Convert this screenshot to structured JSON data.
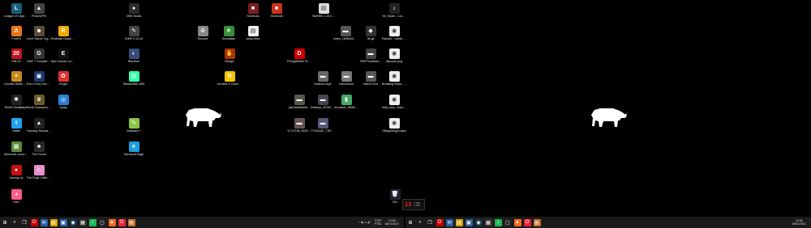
{
  "colors": {
    "desktop": "#000000",
    "taskbar": "#1b1b1b",
    "accent": "#e21b1b"
  },
  "desktop_icons": [
    {
      "label": "League of Legends",
      "glyph": "L",
      "color": "#1a5f7a"
    },
    {
      "label": "ProtonVPN",
      "glyph": "▲",
      "color": "#444"
    },
    {
      "label": "OBS Studio",
      "glyph": "●",
      "color": "#2b2b2b"
    },
    {
      "label": "Shortcuts",
      "glyph": "■",
      "color": "#7a1f1f"
    },
    {
      "label": "Shortcuts",
      "glyph": "■",
      "color": "#c9331f"
    },
    {
      "label": "TabFiles 1.15.2 ...",
      "glyph": "▤",
      "color": "#ddd"
    },
    {
      "label": "Yel_Music - Love...",
      "glyph": "♪",
      "color": "#222"
    },
    {
      "label": "FruitFit",
      "glyph": "Λ",
      "color": "#e8751a"
    },
    {
      "label": "Don't Starve Together",
      "glyph": "☻",
      "color": "#5a4a3a"
    },
    {
      "label": "Rockstar Games Launcher",
      "glyph": "R",
      "color": "#f2a900"
    },
    {
      "label": "GIMP 2.10.24",
      "glyph": "✎",
      "color": "#444"
    },
    {
      "label": "Recycle",
      "glyph": "♻",
      "color": "#888"
    },
    {
      "label": "Snowflake",
      "glyph": "❄",
      "color": "#3a8d3a"
    },
    {
      "label": "setup.tbsd",
      "glyph": "▤",
      "color": "#eee"
    },
    {
      "label": "notes_180604010...",
      "glyph": "▬",
      "color": "#555"
    },
    {
      "label": "3b.gif",
      "glyph": "◆",
      "color": "#333"
    },
    {
      "label": "Rstudio - Latest Paperwork.pdf",
      "glyph": "◉",
      "color": "#eee"
    },
    {
      "label": "Fifa 20",
      "glyph": "20",
      "color": "#c1121f"
    },
    {
      "label": "GMF 7 Complete Edition",
      "glyph": "G",
      "color": "#333"
    },
    {
      "label": "Epic Games Launcher",
      "glyph": "E",
      "color": "#111"
    },
    {
      "label": "BlitzDuel",
      "glyph": "◐",
      "color": "#3a4a7a"
    },
    {
      "label": "BlodyA",
      "glyph": "✋",
      "color": "#a30"
    },
    {
      "label": "PGrigátfolder Signer ....",
      "glyph": "D",
      "color": "#c00"
    },
    {
      "label": "REPT0x4Bmb...",
      "glyph": "▬",
      "color": "#444"
    },
    {
      "label": "discorde.png",
      "glyph": "◉",
      "color": "#eee"
    },
    {
      "label": "Counter-Strike Global Offensive",
      "glyph": "✦",
      "color": "#c88a1a"
    },
    {
      "label": "Euro Truck Simulator 2",
      "glyph": "▣",
      "color": "#1a3a6a"
    },
    {
      "label": "Plugin",
      "glyph": "✿",
      "color": "#d33"
    },
    {
      "label": "Streamlabs OBS",
      "glyph": "▤",
      "color": "#3fa"
    },
    {
      "label": "Acrobat X Gaming Keyboard",
      "glyph": "N",
      "color": "#f4c400"
    },
    {
      "label": "bbdemo.mp4",
      "glyph": "▬",
      "color": "#666"
    },
    {
      "label": "vdeo4more",
      "glyph": "▬",
      "color": "#777"
    },
    {
      "label": "video9 mov",
      "glyph": "▬",
      "color": "#555"
    },
    {
      "label": "Breaking News - Important.mp4",
      "glyph": "◉",
      "color": "#eee"
    },
    {
      "label": "RAGE Multiplayer",
      "glyph": "✱",
      "color": "#222"
    },
    {
      "label": "Tomb Championship",
      "glyph": "♛",
      "color": "#6a5a2a"
    },
    {
      "label": "Uplay",
      "glyph": "◎",
      "color": "#2a7fd4"
    },
    {
      "label": "jaslJiaw08ddla...",
      "glyph": "▬",
      "color": "#554"
    },
    {
      "label": "Desktop_2023031...",
      "glyph": "▬",
      "color": "#445"
    },
    {
      "label": "recorded_180808...",
      "glyph": "▮",
      "color": "#4a6"
    },
    {
      "label": "data_new_ imanes_hi....",
      "glyph": "◉",
      "color": "#eee"
    },
    {
      "label": "Twitter",
      "glyph": "t",
      "color": "#1da1f2"
    },
    {
      "label": "Farming Simulator 19",
      "glyph": "▲",
      "color": "#222"
    },
    {
      "label": "Notepad++",
      "glyph": "✎",
      "color": "#8bc34a"
    },
    {
      "label": "YCTCOM_MOSO...",
      "glyph": "▬",
      "color": "#655"
    },
    {
      "label": "7TDSADE_TMTH...",
      "glyph": "▬",
      "color": "#557"
    },
    {
      "label": "EBeginningGuapa",
      "glyph": "◉",
      "color": "#eee"
    },
    {
      "label": "Minecraft Launcher",
      "glyph": "▩",
      "color": "#5a8d3a"
    },
    {
      "label": "The Forest",
      "glyph": "♣",
      "color": "#2a2a2a"
    },
    {
      "label": "Microsoft Edge",
      "glyph": "e",
      "color": "#1a9fe0"
    },
    {
      "label": "Among Us",
      "glyph": "●",
      "color": "#c51111"
    },
    {
      "label": "Fall Guys: Ultimate Knockout",
      "glyph": "☺",
      "color": "#e78fcf"
    },
    {
      "label": "Kazi",
      "glyph": "◕",
      "color": "#ff5c8a"
    },
    {
      "label": "Bin",
      "glyph": "🗑",
      "color": "#223"
    }
  ],
  "widget": {
    "digits": "13",
    "line1": "1 000",
    "line2": "1 000"
  },
  "taskbar_icons": [
    {
      "name": "start-icon",
      "glyph": "⊞",
      "color": "#1b1b1b"
    },
    {
      "name": "search-icon",
      "glyph": "⌕",
      "color": "#1b1b1b"
    },
    {
      "name": "task-view-icon",
      "glyph": "❐",
      "color": "#1b1b1b"
    },
    {
      "name": "opera-icon",
      "glyph": "O",
      "color": "#c00"
    },
    {
      "name": "mail-icon",
      "glyph": "✉",
      "color": "#2a5fa5"
    },
    {
      "name": "explorer-icon",
      "glyph": "▤",
      "color": "#d9a400"
    },
    {
      "name": "store-icon",
      "glyph": "▣",
      "color": "#2a5fa5"
    },
    {
      "name": "steam-icon",
      "glyph": "◉",
      "color": "#17324a"
    },
    {
      "name": "apps-icon",
      "glyph": "▦",
      "color": "#333"
    },
    {
      "name": "spotify-icon",
      "glyph": "♪",
      "color": "#1db954"
    },
    {
      "name": "generic-icon",
      "glyph": "▢",
      "color": "#222"
    },
    {
      "name": "brave-icon",
      "glyph": "▲",
      "color": "#f56a1d"
    },
    {
      "name": "opera-gx-icon",
      "glyph": "O",
      "color": "#e23"
    },
    {
      "name": "app-icon",
      "glyph": "▤",
      "color": "#c4702a"
    }
  ],
  "tray": {
    "lang_top": "POR",
    "lang_bottom": "PTB2",
    "time": "13:08",
    "date": "08/01/2021",
    "sys_icons": "^ ◉ ▭ 🔊"
  }
}
